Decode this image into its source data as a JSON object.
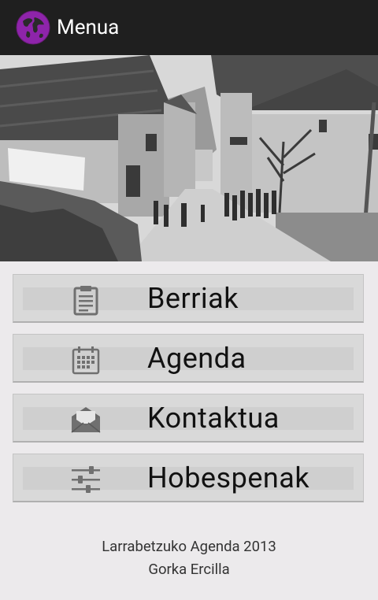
{
  "actionbar": {
    "title": "Menua",
    "icon": "globe-icon",
    "accent": "#8e24aa"
  },
  "banner": {
    "description_icon": "village-photo"
  },
  "menu": {
    "items": [
      {
        "label": "Berriak",
        "icon": "clipboard-icon"
      },
      {
        "label": "Agenda",
        "icon": "calendar-icon"
      },
      {
        "label": "Kontaktua",
        "icon": "mail-icon"
      },
      {
        "label": "Hobespenak",
        "icon": "settings-sliders-icon"
      }
    ]
  },
  "footer": {
    "line1": "Larrabetzuko Agenda 2013",
    "line2": "Gorka Ercilla"
  }
}
